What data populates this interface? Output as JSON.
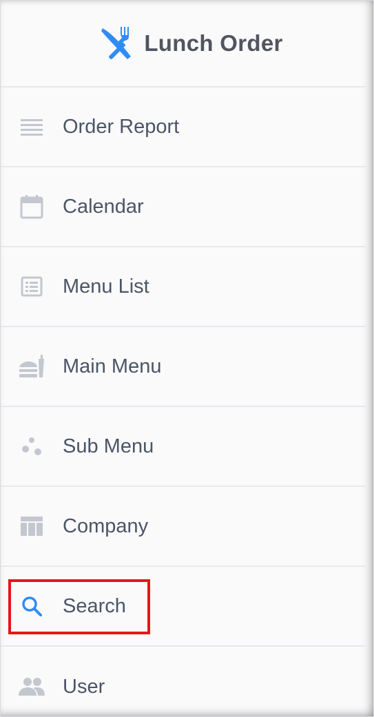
{
  "app": {
    "title": "Lunch Order",
    "accent_color": "#2f8cf5",
    "icon_color": "#b9bec8",
    "highlight_color": "#e8141b"
  },
  "sidebar": {
    "items": [
      {
        "label": "Order Report",
        "icon": "list-lines-icon"
      },
      {
        "label": "Calendar",
        "icon": "calendar-icon"
      },
      {
        "label": "Menu List",
        "icon": "list-alt-icon"
      },
      {
        "label": "Main Menu",
        "icon": "fast-food-icon"
      },
      {
        "label": "Sub Menu",
        "icon": "scatter-dots-icon"
      },
      {
        "label": "Company",
        "icon": "table-icon"
      },
      {
        "label": "Search",
        "icon": "search-icon",
        "active": true
      },
      {
        "label": "User",
        "icon": "users-icon"
      }
    ]
  }
}
